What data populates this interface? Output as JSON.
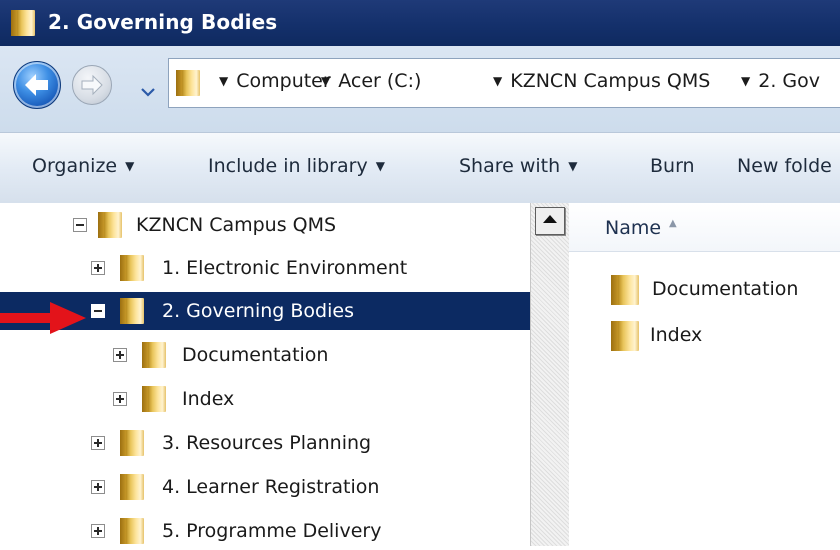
{
  "window": {
    "title": "2. Governing Bodies"
  },
  "address_bar": {
    "breadcrumbs": [
      "Computer",
      "Acer (C:)",
      "KZNCN Campus QMS",
      "2. Gov"
    ]
  },
  "toolbar": {
    "organize": "Organize",
    "include_in_library": "Include in library",
    "share_with": "Share with",
    "burn": "Burn",
    "new_folder": "New folde"
  },
  "nav_tree": {
    "items": [
      {
        "label": "KZNCN Campus QMS",
        "expander": "minus",
        "level": 0,
        "selected": false
      },
      {
        "label": "1. Electronic Environment",
        "expander": "plus",
        "level": 1,
        "selected": false
      },
      {
        "label": "2. Governing Bodies",
        "expander": "minus",
        "level": 1,
        "selected": true
      },
      {
        "label": "Documentation",
        "expander": "plus",
        "level": 2,
        "selected": false
      },
      {
        "label": "Index",
        "expander": "plus",
        "level": 2,
        "selected": false
      },
      {
        "label": "3. Resources Planning",
        "expander": "plus",
        "level": 1,
        "selected": false
      },
      {
        "label": "4. Learner Registration",
        "expander": "plus",
        "level": 1,
        "selected": false
      },
      {
        "label": "5. Programme Delivery",
        "expander": "plus",
        "level": 1,
        "selected": false
      }
    ]
  },
  "content": {
    "column_header": "Name",
    "items": [
      {
        "label": "Documentation"
      },
      {
        "label": "Index"
      }
    ]
  },
  "colors": {
    "title_bar": "#14306b",
    "selection": "#0c2a62",
    "annotation_arrow": "#e3131a"
  },
  "icons": [
    "folder-icon",
    "back-arrow-icon",
    "forward-arrow-icon",
    "history-dropdown-icon",
    "breadcrumb-chevron-icon",
    "sort-ascending-icon",
    "scroll-up-arrow-icon",
    "red-annotation-arrow-icon"
  ]
}
